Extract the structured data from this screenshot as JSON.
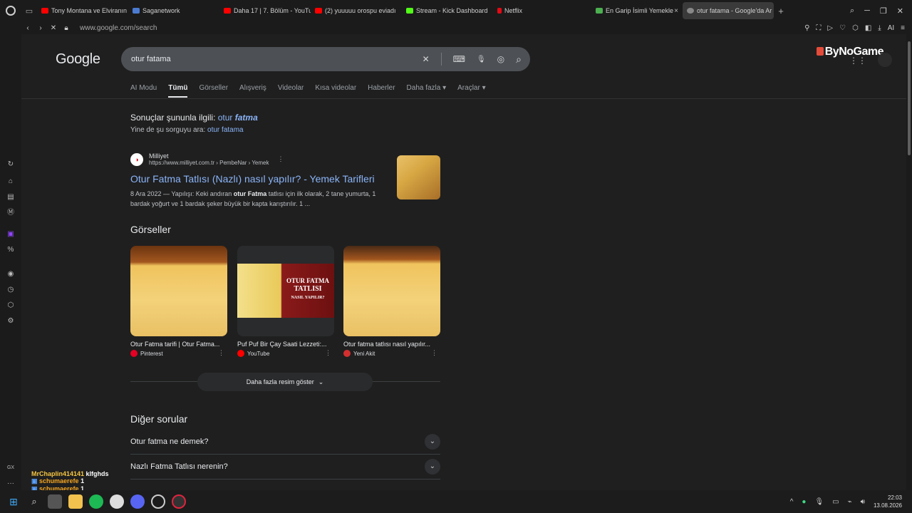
{
  "browser": {
    "workspace_icon": "▭",
    "tabs": [
      {
        "label": "Tony Montana ve Elviranın",
        "fav_color": "#ff0000"
      },
      {
        "label": "Saganetwork",
        "fav_color": "#4a7bd0"
      },
      {
        "label": "Daha 17 | 7. Bölüm - YouTu",
        "fav_color": "#ff0000"
      },
      {
        "label": "(2) yuuuuu orospu eviadı",
        "fav_color": "#ff0000"
      },
      {
        "label": "Stream - Kick Dashboard",
        "fav_color": "#53fc18"
      },
      {
        "label": "Netflix",
        "fav_color": "#e50914"
      },
      {
        "label": "En Garip İsimli Yemekle",
        "fav_color": "#4caf50"
      },
      {
        "label": "otur fatama - Google'da Ar",
        "fav_color": "#888888"
      }
    ],
    "close_tab": "×",
    "new_tab": "+",
    "url": "www.google.com/search"
  },
  "google": {
    "logo": "Google",
    "query": "otur fatama",
    "clear_icon": "✕",
    "keyboard_icon": "⌨",
    "mic_icon": "🎙",
    "lens_icon": "◎",
    "search_icon": "⌕",
    "tabs": [
      "AI Modu",
      "Tümü",
      "Görseller",
      "Alışveriş",
      "Videolar",
      "Kısa videolar",
      "Haberler",
      "Daha fazla ▾",
      "Araçlar ▾"
    ],
    "brand": "ByNoGame",
    "apps_icon": "⋮⋮",
    "correction_prefix": "Sonuçlar şununla ilgili: ",
    "correction_word1": "otur ",
    "correction_word2": "fatma",
    "instead_prefix": "Yine de şu sorguyu ara: ",
    "instead_link": "otur fatama"
  },
  "result": {
    "site_name": "Milliyet",
    "site_url": "https://www.milliyet.com.tr › PembeNar › Yemek",
    "title": "Otur Fatma Tatlısı (Nazlı) nasıl yapılır? - Yemek Tarifleri",
    "snippet_date": "8 Ara 2022 — Yapılışı: Keki andıran ",
    "snippet_bold": "otur Fatma",
    "snippet_rest": " tatlısı için ilk olarak, 2 tane yumurta, 1 bardak yoğurt ve 1 bardak şeker büyük bir kapta karıştırılır. 1 ..."
  },
  "images": {
    "heading": "Görseller",
    "items": [
      {
        "caption": "Otur Fatma tarifi | Otur Fatma...",
        "source": "Pinterest",
        "src_color": "#e60023"
      },
      {
        "caption": "Puf Puf Bir Çay Saati Lezzeti:...",
        "source": "YouTube",
        "src_color": "#ff0000"
      },
      {
        "caption": "Otur fatma tatlısı nasıl yapılır...",
        "source": "Yeni Akit",
        "src_color": "#d32f2f"
      }
    ],
    "overlay_line1": "OTUR FATMA",
    "overlay_line2": "TATLISI",
    "overlay_line3": "NASIL YAPILIR?",
    "more": "Daha fazla resim göster"
  },
  "paa": {
    "heading": "Diğer sorular",
    "questions": [
      "Otur fatma ne demek?",
      "Nazlı Fatma Tatlısı nerenin?"
    ]
  },
  "chat": {
    "line1_user": "MrChaplin414141",
    "line1_msg": "klfghds",
    "line2_user": "schumaerefe",
    "line2_msg": "1",
    "line3_user": "schumaerefe",
    "line3_msg": "1"
  },
  "taskbar": {
    "time": "22:03",
    "date": "13.08.2026"
  }
}
